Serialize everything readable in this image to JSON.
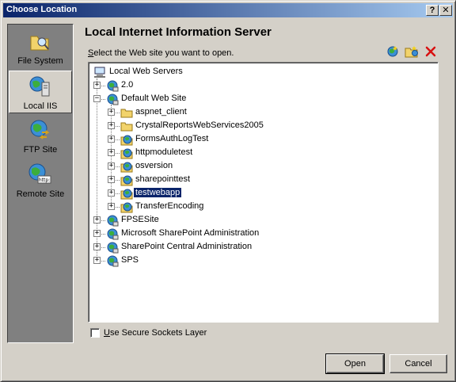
{
  "window": {
    "title": "Choose Location",
    "help_glyph": "?",
    "close_glyph": "✕"
  },
  "places": [
    {
      "label": "File System",
      "icon": "folder-search-icon",
      "selected": false
    },
    {
      "label": "Local IIS",
      "icon": "local-iis-icon",
      "selected": true
    },
    {
      "label": "FTP Site",
      "icon": "ftp-globe-icon",
      "selected": false
    },
    {
      "label": "Remote Site",
      "icon": "remote-http-globe-icon",
      "selected": false
    }
  ],
  "header": {
    "title": "Local Internet Information Server",
    "instruction_prefix": "S",
    "instruction_rest": "elect the Web site you want to open."
  },
  "toolbar": {
    "icons": [
      "create-web-application-icon",
      "new-virtual-directory-icon",
      "delete-icon"
    ]
  },
  "tree": {
    "root": "Local Web Servers",
    "nodes": [
      {
        "label": "2.0",
        "level": 1,
        "expander": "+",
        "icon": "web-globe-icon"
      },
      {
        "label": "Default Web Site",
        "level": 1,
        "expander": "−",
        "icon": "web-globe-icon"
      },
      {
        "label": "aspnet_client",
        "level": 2,
        "expander": "+",
        "icon": "folder-icon"
      },
      {
        "label": "CrystalReportsWebServices2005",
        "level": 2,
        "expander": "+",
        "icon": "folder-icon"
      },
      {
        "label": "FormsAuthLogTest",
        "level": 2,
        "expander": "+",
        "icon": "web-app-icon"
      },
      {
        "label": "httpmoduletest",
        "level": 2,
        "expander": "+",
        "icon": "web-app-icon"
      },
      {
        "label": "osversion",
        "level": 2,
        "expander": "+",
        "icon": "web-app-icon"
      },
      {
        "label": "sharepointtest",
        "level": 2,
        "expander": "+",
        "icon": "web-app-icon"
      },
      {
        "label": "testwebapp",
        "level": 2,
        "expander": "+",
        "icon": "web-app-icon",
        "selected": true
      },
      {
        "label": "TransferEncoding",
        "level": 2,
        "expander": "+",
        "icon": "web-app-icon"
      },
      {
        "label": "FPSESite",
        "level": 1,
        "expander": "+",
        "icon": "web-globe-icon"
      },
      {
        "label": "Microsoft SharePoint Administration",
        "level": 1,
        "expander": "+",
        "icon": "web-globe-icon"
      },
      {
        "label": "SharePoint Central Administration",
        "level": 1,
        "expander": "+",
        "icon": "web-globe-icon"
      },
      {
        "label": "SPS",
        "level": 1,
        "expander": "+",
        "icon": "web-globe-icon"
      }
    ]
  },
  "ssl": {
    "prefix": "U",
    "rest": "se Secure Sockets Layer",
    "checked": false
  },
  "buttons": {
    "open": "Open",
    "cancel": "Cancel"
  },
  "colors": {
    "titlebar_start": "#0a246a",
    "titlebar_end": "#a6caf0",
    "selection": "#0a246a",
    "face": "#d4d0c8"
  }
}
